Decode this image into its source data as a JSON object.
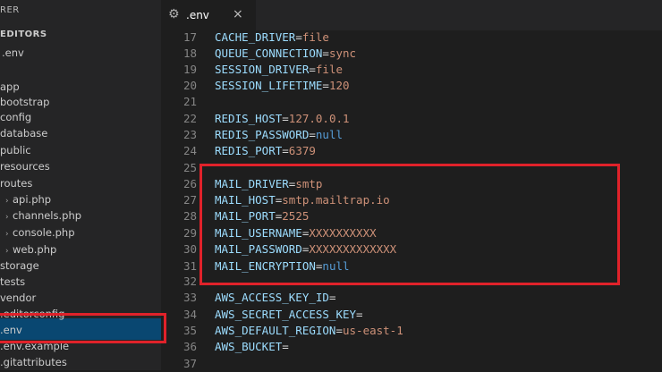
{
  "sidebar": {
    "header": "RER",
    "section_open_editors": "EDITORS",
    "open_editor_item": ".env",
    "items": [
      {
        "label": "app",
        "type": "folder"
      },
      {
        "label": "bootstrap",
        "type": "folder"
      },
      {
        "label": "config",
        "type": "folder"
      },
      {
        "label": "database",
        "type": "folder"
      },
      {
        "label": "public",
        "type": "folder"
      },
      {
        "label": "resources",
        "type": "folder"
      },
      {
        "label": "routes",
        "type": "folder"
      },
      {
        "label": "api.php",
        "type": "file"
      },
      {
        "label": "channels.php",
        "type": "file"
      },
      {
        "label": "console.php",
        "type": "file"
      },
      {
        "label": "web.php",
        "type": "file"
      },
      {
        "label": "storage",
        "type": "folder"
      },
      {
        "label": "tests",
        "type": "folder"
      },
      {
        "label": "vendor",
        "type": "folder"
      },
      {
        "label": ".editorconfig",
        "type": "file"
      },
      {
        "label": ".env",
        "type": "file",
        "selected": true
      },
      {
        "label": ".env.example",
        "type": "file"
      },
      {
        "label": ".gitattributes",
        "type": "file"
      }
    ]
  },
  "tab": {
    "label": ".env",
    "icon": "gear-icon",
    "close": "×"
  },
  "editor": {
    "lines": [
      {
        "num": "17",
        "key": "CACHE_DRIVER",
        "val": "file"
      },
      {
        "num": "18",
        "key": "QUEUE_CONNECTION",
        "val": "sync"
      },
      {
        "num": "19",
        "key": "SESSION_DRIVER",
        "val": "file"
      },
      {
        "num": "20",
        "key": "SESSION_LIFETIME",
        "val": "120"
      },
      {
        "num": "21",
        "key": "",
        "val": ""
      },
      {
        "num": "22",
        "key": "REDIS_HOST",
        "val": "127.0.0.1"
      },
      {
        "num": "23",
        "key": "REDIS_PASSWORD",
        "val": "null"
      },
      {
        "num": "24",
        "key": "REDIS_PORT",
        "val": "6379"
      },
      {
        "num": "25",
        "key": "",
        "val": ""
      },
      {
        "num": "26",
        "key": "MAIL_DRIVER",
        "val": "smtp"
      },
      {
        "num": "27",
        "key": "MAIL_HOST",
        "val": "smtp.mailtrap.io"
      },
      {
        "num": "28",
        "key": "MAIL_PORT",
        "val": "2525"
      },
      {
        "num": "29",
        "key": "MAIL_USERNAME",
        "val": "XXXXXXXXXX"
      },
      {
        "num": "30",
        "key": "MAIL_PASSWORD",
        "val": "XXXXXXXXXXXXX"
      },
      {
        "num": "31",
        "key": "MAIL_ENCRYPTION",
        "val": "null"
      },
      {
        "num": "32",
        "key": "",
        "val": ""
      },
      {
        "num": "33",
        "key": "AWS_ACCESS_KEY_ID",
        "val": ""
      },
      {
        "num": "34",
        "key": "AWS_SECRET_ACCESS_KEY",
        "val": ""
      },
      {
        "num": "35",
        "key": "AWS_DEFAULT_REGION",
        "val": "us-east-1"
      },
      {
        "num": "36",
        "key": "AWS_BUCKET",
        "val": ""
      },
      {
        "num": "37",
        "key": "",
        "val": ""
      }
    ]
  },
  "colors": {
    "highlight_border": "#e0222a",
    "selection_bg": "#094771",
    "key_color": "#9cdcfe",
    "value_color": "#ce9178",
    "null_color": "#569cd6"
  }
}
